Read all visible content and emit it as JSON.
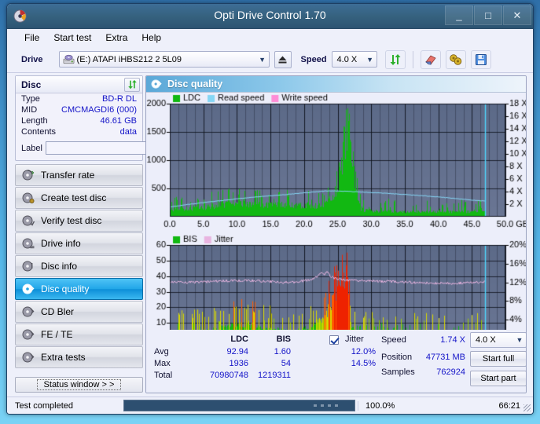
{
  "window": {
    "title": "Opti Drive Control 1.70",
    "app_icon": "disc-icon",
    "minimize": "_",
    "maximize": "□",
    "close": "✕"
  },
  "menu": [
    {
      "label": "File"
    },
    {
      "label": "Start test"
    },
    {
      "label": "Extra"
    },
    {
      "label": "Help"
    }
  ],
  "toolbar": {
    "drive_label": "Drive",
    "drive_value": "(E:)  ATAPI iHBS212  2 5L09",
    "eject_icon": "eject-icon",
    "speed_label": "Speed",
    "speed_value": "4.0 X",
    "refresh_icon": "refresh-icon",
    "erase_icon": "eraser-icon",
    "settings_icon": "gears-icon",
    "save_icon": "floppy-save-icon"
  },
  "disc": {
    "title": "Disc",
    "refresh_icon": "refresh-icon",
    "rows": [
      {
        "key": "Type",
        "value": "BD-R DL"
      },
      {
        "key": "MID",
        "value": "CMCMAGDI6 (000)"
      },
      {
        "key": "Length",
        "value": "46.61 GB"
      },
      {
        "key": "Contents",
        "value": "data"
      }
    ],
    "label_key": "Label",
    "label_value": "",
    "label_placeholder": "",
    "disc_icon": "cd-disc-icon"
  },
  "nav": {
    "items": [
      {
        "label": "Transfer rate",
        "icon": "disc-test-icon",
        "selected": false
      },
      {
        "label": "Create test disc",
        "icon": "disc-burn-icon",
        "selected": false
      },
      {
        "label": "Verify test disc",
        "icon": "disc-verify-icon",
        "selected": false
      },
      {
        "label": "Drive info",
        "icon": "disc-info-icon",
        "selected": false
      },
      {
        "label": "Disc info",
        "icon": "disc-info2-icon",
        "selected": false
      },
      {
        "label": "Disc quality",
        "icon": "disc-quality-icon",
        "selected": true
      },
      {
        "label": "CD Bler",
        "icon": "disc-bler-icon",
        "selected": false
      },
      {
        "label": "FE / TE",
        "icon": "disc-fete-icon",
        "selected": false
      },
      {
        "label": "Extra tests",
        "icon": "disc-extra-icon",
        "selected": false
      }
    ],
    "status_window": "Status window > >"
  },
  "panel": {
    "header_title": "Disc quality",
    "header_icon": "disc-quality-icon"
  },
  "chart_data": [
    {
      "type": "area",
      "id": "ldc-chart",
      "title": "Disc quality - LDC",
      "xlabel": "GB",
      "ylabel": "",
      "xlim": [
        0.0,
        50.0
      ],
      "ylim": [
        0,
        2000
      ],
      "xticks": [
        "0.0",
        "5.0",
        "10.0",
        "15.0",
        "20.0",
        "25.0",
        "30.0",
        "35.0",
        "40.0",
        "45.0",
        "50.0 GB"
      ],
      "yticks": [
        "500",
        "1000",
        "1500",
        "2000"
      ],
      "y2ticks": [
        "2 X",
        "4 X",
        "6 X",
        "8 X",
        "10 X",
        "12 X",
        "14 X",
        "16 X",
        "18 X"
      ],
      "y2lim": [
        0,
        18
      ],
      "grid": true,
      "legend_position": "top-left",
      "legend": [
        {
          "name": "LDC",
          "color": "#12b812"
        },
        {
          "name": "Read speed",
          "color": "#85d6f5"
        },
        {
          "name": "Write speed",
          "color": "#ff8cd6"
        }
      ],
      "series": [
        {
          "name": "LDC",
          "color": "#12b812",
          "kind": "bars",
          "x_end": 46.9,
          "baseline": [
            150,
            160,
            165,
            170,
            175,
            180,
            185,
            190,
            195,
            200,
            205,
            215,
            225,
            235,
            245,
            255,
            268,
            280,
            300,
            320,
            340,
            330,
            315,
            305,
            300,
            295,
            292,
            290,
            288,
            285,
            283,
            280,
            278,
            276,
            274,
            272,
            270,
            268,
            266,
            264,
            262,
            260,
            258,
            256,
            254,
            252,
            250,
            255,
            270,
            300,
            350,
            430,
            560,
            760,
            1100,
            1550,
            1936,
            1500,
            900,
            430,
            180,
            150,
            140,
            135,
            130,
            128,
            126,
            124,
            122,
            120,
            118,
            116,
            115,
            114,
            113,
            112,
            112,
            111,
            111,
            110,
            110,
            110,
            110,
            110,
            110,
            110,
            110,
            110,
            110,
            110,
            110,
            110,
            112,
            115,
            118,
            120,
            120,
            118,
            115,
            112
          ],
          "noise_amp": 110,
          "spike_prob": 0.22
        },
        {
          "name": "Read speed",
          "color": "#85d6f5",
          "kind": "line",
          "axis": "right",
          "x_end": 46.9,
          "values_x": [
            0.0,
            2.0,
            5.0,
            8.0,
            11.0,
            14.0,
            17.0,
            20.0,
            23.2,
            25.0,
            28.0,
            31.0,
            34.0,
            37.0,
            40.0,
            43.0,
            46.0,
            46.9
          ],
          "values_y": [
            1.55,
            1.85,
            2.25,
            2.6,
            2.95,
            3.25,
            3.5,
            3.8,
            4.1,
            4.1,
            3.95,
            3.8,
            3.6,
            3.4,
            3.15,
            2.85,
            2.55,
            2.5
          ]
        },
        {
          "name": "Write speed",
          "color": "#ff8cd6",
          "kind": "line",
          "axis": "right",
          "values_x": [],
          "values_y": []
        },
        {
          "name": "end-marker",
          "color": "#4fd8ff",
          "kind": "vline",
          "x": 46.95
        }
      ]
    },
    {
      "type": "area",
      "id": "bis-jitter-chart",
      "title": "Disc quality - BIS / Jitter",
      "xlabel": "GB",
      "ylabel": "",
      "xlim": [
        0.0,
        50.0
      ],
      "ylim": [
        0,
        60
      ],
      "xticks": [
        "0.0",
        "5.0",
        "10.0",
        "15.0",
        "20.0",
        "25.0",
        "30.0",
        "35.0",
        "40.0",
        "45.0",
        "50.0 GB"
      ],
      "yticks": [
        "10",
        "20",
        "30",
        "40",
        "50",
        "60"
      ],
      "y2ticks": [
        "4%",
        "8%",
        "12%",
        "16%",
        "20%"
      ],
      "y2lim": [
        0,
        20
      ],
      "grid": true,
      "legend_position": "top-left",
      "legend": [
        {
          "name": "BIS",
          "color": "#12b812"
        },
        {
          "name": "Jitter",
          "color": "#e8b4e0"
        }
      ],
      "series": [
        {
          "name": "BIS",
          "color": "#12b812",
          "hot_color": "#ee2200",
          "warm_color": "#d8d800",
          "kind": "bars",
          "x_end": 46.9,
          "baseline": [
            5,
            5,
            5,
            5,
            5,
            5,
            5,
            6,
            6,
            6,
            6,
            6,
            7,
            7,
            8,
            8,
            9,
            9,
            10,
            10,
            11,
            11,
            12,
            12,
            12,
            11,
            11,
            10,
            10,
            9,
            9,
            8,
            8,
            8,
            7,
            7,
            7,
            7,
            7,
            7,
            7,
            7,
            8,
            9,
            10,
            12,
            14,
            16,
            19,
            22,
            26,
            30,
            35,
            40,
            46,
            52,
            54,
            12,
            6,
            5,
            5,
            5,
            4,
            4,
            4,
            4,
            4,
            4,
            4,
            4,
            4,
            4,
            4,
            4,
            4,
            4,
            4,
            4,
            4,
            4,
            4,
            4,
            4,
            4,
            4,
            4,
            4,
            4,
            4,
            4,
            4,
            4,
            4,
            4,
            4,
            4,
            4,
            4,
            4,
            4
          ],
          "noise_amp": 7,
          "spike_prob": 0.3
        },
        {
          "name": "Jitter",
          "color": "#e8b4e0",
          "kind": "line",
          "axis": "left",
          "x_end": 46.9,
          "values_x": [
            0.0,
            1.0,
            3.0,
            5.0,
            7.0,
            9.0,
            11.0,
            13.0,
            15.0,
            17.0,
            19.0,
            21.0,
            22.0,
            22.6,
            23.0,
            23.4,
            24.0,
            25.0,
            27.0,
            30.0,
            33.0,
            36.0,
            39.0,
            42.0,
            45.0,
            46.9
          ],
          "values_y": [
            36.5,
            36.2,
            36.0,
            36.2,
            36.8,
            37.0,
            37.2,
            37.0,
            36.5,
            36.0,
            36.2,
            38.0,
            40.0,
            42.5,
            41.0,
            43.0,
            39.5,
            38.0,
            37.2,
            36.8,
            36.5,
            36.0,
            35.5,
            35.4,
            35.8,
            36.5
          ]
        },
        {
          "name": "end-marker",
          "color": "#4fd8ff",
          "kind": "vline",
          "x": 46.95
        }
      ]
    }
  ],
  "stats": {
    "col_ldc": "LDC",
    "col_bis": "BIS",
    "jitter_label": "Jitter",
    "jitter_checked": true,
    "rows": [
      {
        "label": "Avg",
        "ldc": "92.94",
        "bis": "1.60",
        "jitter": "12.0%"
      },
      {
        "label": "Max",
        "ldc": "1936",
        "bis": "54",
        "jitter": "14.5%"
      },
      {
        "label": "Total",
        "ldc": "70980748",
        "bis": "1219311",
        "jitter": ""
      }
    ],
    "speed_label": "Speed",
    "speed_value": "1.74 X",
    "position_label": "Position",
    "position_value": "47731 MB",
    "samples_label": "Samples",
    "samples_value": "762924",
    "speed_select": "4.0 X",
    "start_full": "Start full",
    "start_part": "Start part"
  },
  "statusbar": {
    "text": "Test completed",
    "percent": "100.0%",
    "progress_value": 100,
    "time": "66:21"
  }
}
